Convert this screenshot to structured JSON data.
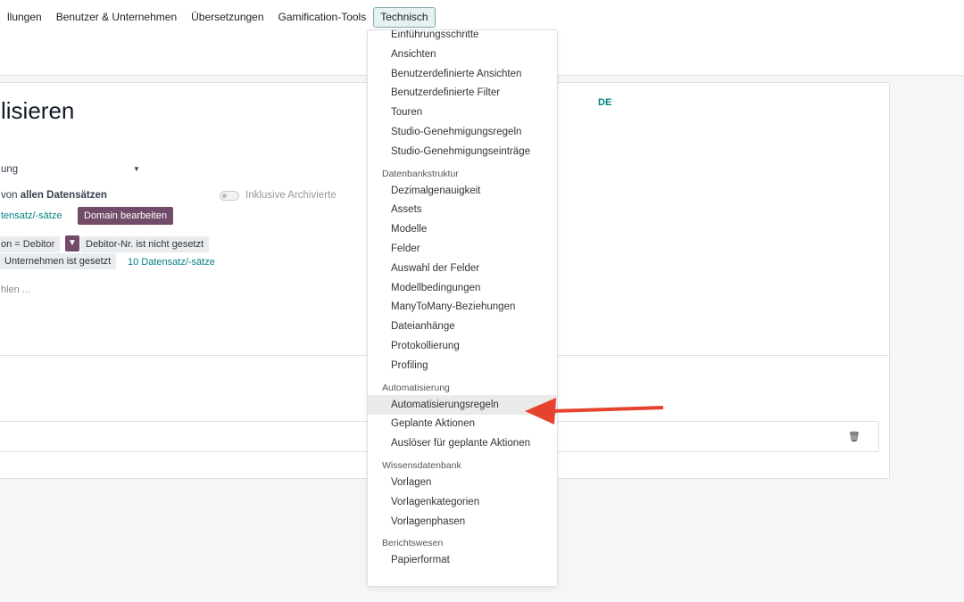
{
  "nav": [
    "llungen",
    "Benutzer & Unternehmen",
    "Übersetzungen",
    "Gamification-Tools",
    "Technisch"
  ],
  "form": {
    "title": "lisieren",
    "lang": "DE",
    "select_value": "ung",
    "records_prefix": "von",
    "records_bold": "allen Datensätzen",
    "archived_label": "Inklusive Archivierte",
    "records_link": "tensatz/-sätze",
    "domain_button": "Domain bearbeiten",
    "chip1": "on = Debitor",
    "chip2": "Debitor-Nr. ist nicht gesetzt",
    "chip3": "Unternehmen ist gesetzt",
    "count_link": "10 Datensatz/-sätze",
    "placeholder": "hlen ..."
  },
  "menu": [
    {
      "type": "item",
      "label": "Einführungsschritte"
    },
    {
      "type": "item",
      "label": "Ansichten"
    },
    {
      "type": "item",
      "label": "Benutzerdefinierte Ansichten"
    },
    {
      "type": "item",
      "label": "Benutzerdefinierte Filter"
    },
    {
      "type": "item",
      "label": "Touren"
    },
    {
      "type": "item",
      "label": "Studio-Genehmigungsregeln"
    },
    {
      "type": "item",
      "label": "Studio-Genehmigungseinträge"
    },
    {
      "type": "header",
      "label": "Datenbankstruktur"
    },
    {
      "type": "item",
      "label": "Dezimalgenauigkeit"
    },
    {
      "type": "item",
      "label": "Assets"
    },
    {
      "type": "item",
      "label": "Modelle"
    },
    {
      "type": "item",
      "label": "Felder"
    },
    {
      "type": "item",
      "label": "Auswahl der Felder"
    },
    {
      "type": "item",
      "label": "Modellbedingungen"
    },
    {
      "type": "item",
      "label": "ManyToMany-Beziehungen"
    },
    {
      "type": "item",
      "label": "Dateianhänge"
    },
    {
      "type": "item",
      "label": "Protokollierung"
    },
    {
      "type": "item",
      "label": "Profiling"
    },
    {
      "type": "header",
      "label": "Automatisierung"
    },
    {
      "type": "item",
      "label": "Automatisierungsregeln",
      "highlight": true
    },
    {
      "type": "item",
      "label": "Geplante Aktionen"
    },
    {
      "type": "item",
      "label": "Auslöser für geplante Aktionen"
    },
    {
      "type": "header",
      "label": "Wissensdatenbank"
    },
    {
      "type": "item",
      "label": "Vorlagen"
    },
    {
      "type": "item",
      "label": "Vorlagenkategorien"
    },
    {
      "type": "item",
      "label": "Vorlagenphasen"
    },
    {
      "type": "header",
      "label": "Berichtswesen"
    },
    {
      "type": "item",
      "label": "Papierformat"
    }
  ],
  "colors": {
    "brand": "#714b67",
    "link": "#017e84",
    "arrow": "#e5432d"
  }
}
